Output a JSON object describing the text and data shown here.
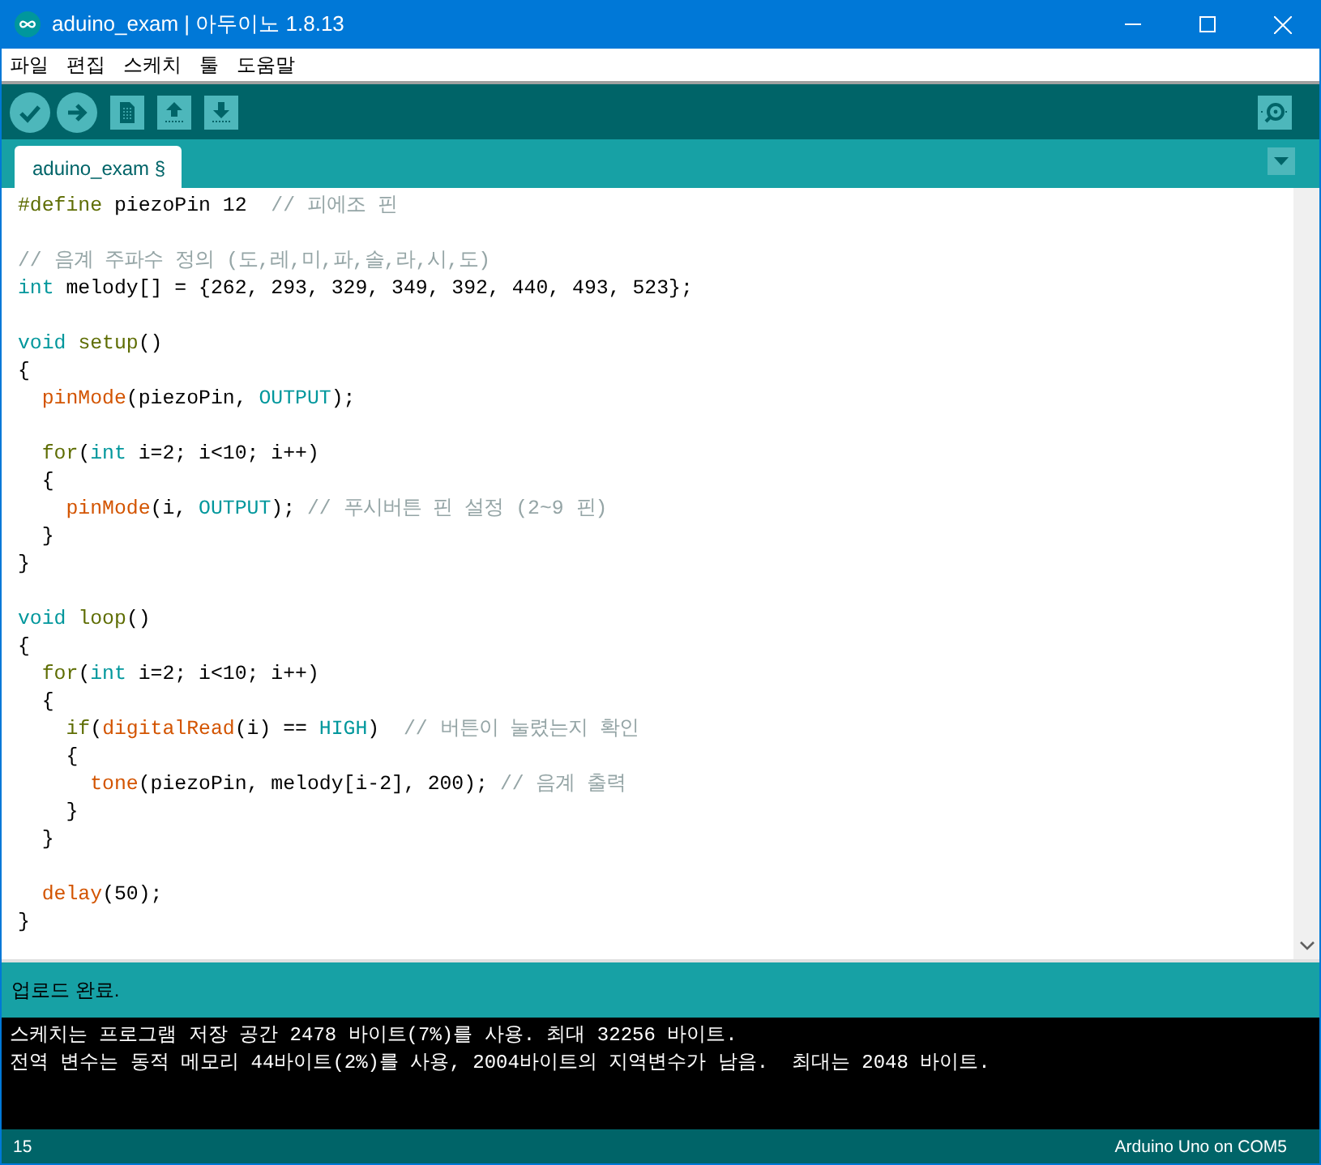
{
  "window": {
    "title": "aduino_exam | 아두이노 1.8.13"
  },
  "menu": [
    "파일",
    "편집",
    "스케치",
    "툴",
    "도움말"
  ],
  "tabs": [
    {
      "label": "aduino_exam §",
      "selected": true
    }
  ],
  "code": {
    "lines": [
      {
        "kind": "code",
        "tokens": [
          {
            "text": "#define",
            "kind": "struct"
          },
          {
            "text": " piezoPin 12  ",
            "kind": "plain"
          },
          {
            "text": "// 피에조 핀",
            "kind": "comment"
          }
        ]
      },
      {
        "kind": "blank"
      },
      {
        "kind": "code",
        "tokens": [
          {
            "text": "// 음계 주파수 정의 (도,레,미,파,솔,라,시,도)",
            "kind": "comment"
          }
        ]
      },
      {
        "kind": "code",
        "tokens": [
          {
            "text": "int",
            "kind": "type"
          },
          {
            "text": " melody[] = {262, 293, 329, 349, 392, 440, 493, 523};",
            "kind": "plain"
          }
        ]
      },
      {
        "kind": "blank"
      },
      {
        "kind": "code",
        "tokens": [
          {
            "text": "void ",
            "kind": "type"
          },
          {
            "text": "setup",
            "kind": "struct"
          },
          {
            "text": "()",
            "kind": "plain"
          }
        ]
      },
      {
        "kind": "code",
        "tokens": [
          {
            "text": "{",
            "kind": "plain"
          }
        ]
      },
      {
        "kind": "code",
        "tokens": [
          {
            "text": "  pinMode",
            "kind": "func"
          },
          {
            "text": "(piezoPin, ",
            "kind": "plain"
          },
          {
            "text": "OUTPUT",
            "kind": "const"
          },
          {
            "text": ");",
            "kind": "plain"
          }
        ]
      },
      {
        "kind": "blank"
      },
      {
        "kind": "code",
        "tokens": [
          {
            "text": "  for",
            "kind": "struct"
          },
          {
            "text": "(",
            "kind": "plain"
          },
          {
            "text": "int",
            "kind": "type"
          },
          {
            "text": " i=2; i<10; i++)",
            "kind": "plain"
          }
        ]
      },
      {
        "kind": "code",
        "tokens": [
          {
            "text": "  {",
            "kind": "plain"
          }
        ]
      },
      {
        "kind": "code",
        "tokens": [
          {
            "text": "    pinMode",
            "kind": "func"
          },
          {
            "text": "(i, ",
            "kind": "plain"
          },
          {
            "text": "OUTPUT",
            "kind": "const"
          },
          {
            "text": "); ",
            "kind": "plain"
          },
          {
            "text": "// 푸시버튼 핀 설정 (2~9 핀)",
            "kind": "comment"
          }
        ]
      },
      {
        "kind": "code",
        "tokens": [
          {
            "text": "  }",
            "kind": "plain"
          }
        ]
      },
      {
        "kind": "code",
        "tokens": [
          {
            "text": "}",
            "kind": "plain"
          }
        ]
      },
      {
        "kind": "blank"
      },
      {
        "kind": "code",
        "tokens": [
          {
            "text": "void ",
            "kind": "type"
          },
          {
            "text": "loop",
            "kind": "struct"
          },
          {
            "text": "()",
            "kind": "plain"
          }
        ]
      },
      {
        "kind": "code",
        "tokens": [
          {
            "text": "{",
            "kind": "plain"
          }
        ]
      },
      {
        "kind": "code",
        "tokens": [
          {
            "text": "  for",
            "kind": "struct"
          },
          {
            "text": "(",
            "kind": "plain"
          },
          {
            "text": "int",
            "kind": "type"
          },
          {
            "text": " i=2; i<10; i++)",
            "kind": "plain"
          }
        ]
      },
      {
        "kind": "code",
        "tokens": [
          {
            "text": "  {",
            "kind": "plain"
          }
        ]
      },
      {
        "kind": "code",
        "tokens": [
          {
            "text": "    if",
            "kind": "struct"
          },
          {
            "text": "(",
            "kind": "plain"
          },
          {
            "text": "digitalRead",
            "kind": "func"
          },
          {
            "text": "(i) == ",
            "kind": "plain"
          },
          {
            "text": "HIGH",
            "kind": "const"
          },
          {
            "text": ")  ",
            "kind": "plain"
          },
          {
            "text": "// 버튼이 눌렸는지 확인",
            "kind": "comment"
          }
        ]
      },
      {
        "kind": "code",
        "tokens": [
          {
            "text": "    {",
            "kind": "plain"
          }
        ]
      },
      {
        "kind": "code",
        "tokens": [
          {
            "text": "      tone",
            "kind": "func"
          },
          {
            "text": "(piezoPin, melody[i-2], 200); ",
            "kind": "plain"
          },
          {
            "text": "// 음계 출력",
            "kind": "comment"
          }
        ]
      },
      {
        "kind": "code",
        "tokens": [
          {
            "text": "    }",
            "kind": "plain"
          }
        ]
      },
      {
        "kind": "code",
        "tokens": [
          {
            "text": "  }",
            "kind": "plain"
          }
        ]
      },
      {
        "kind": "blank"
      },
      {
        "kind": "code",
        "tokens": [
          {
            "text": "  delay",
            "kind": "func"
          },
          {
            "text": "(50);",
            "kind": "plain"
          }
        ]
      },
      {
        "kind": "code",
        "tokens": [
          {
            "text": "}",
            "kind": "plain"
          }
        ]
      }
    ]
  },
  "status": {
    "message": "업로드 완료."
  },
  "console": {
    "lines": [
      "스케치는 프로그램 저장 공간 2478 바이트(7%)를 사용. 최대 32256 바이트.",
      "전역 변수는 동적 메모리 44바이트(2%)를 사용, 2004바이트의 지역변수가 남음.  최대는 2048 바이트."
    ]
  },
  "status_bar": {
    "line": "15",
    "board": "Arduino Uno on COM5"
  }
}
